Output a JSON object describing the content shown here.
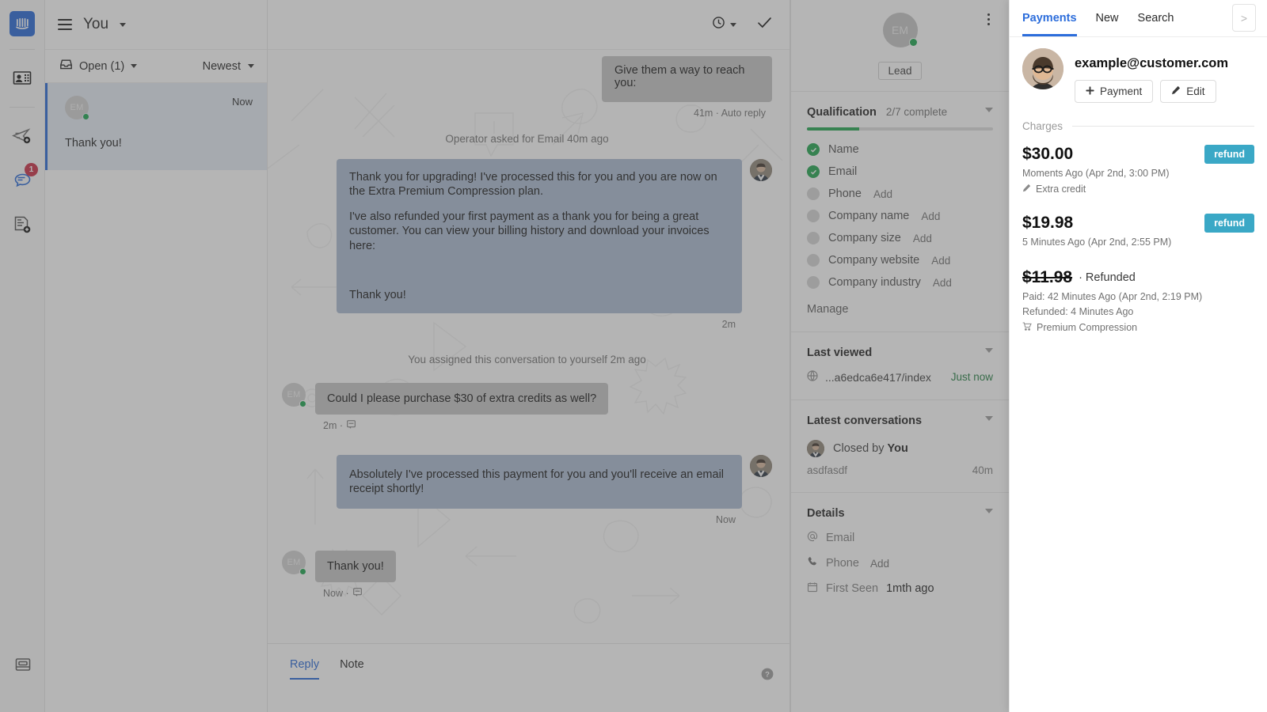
{
  "rail": {
    "logo_name": "intercom-logo",
    "items": [
      {
        "name": "contacts-icon",
        "badge": null
      },
      {
        "name": "send-message-icon",
        "badge": null
      },
      {
        "name": "conversations-icon",
        "badge": "1"
      },
      {
        "name": "articles-icon",
        "badge": null
      }
    ],
    "bottom_item": {
      "name": "inbox-icon"
    }
  },
  "conversation_list": {
    "header_title": "You",
    "filter_label": "Open (1)",
    "sort_label": "Newest",
    "items": [
      {
        "avatar_initials": "EM",
        "time": "Now",
        "snippet": "Thank you!"
      }
    ]
  },
  "conversation": {
    "header": {
      "snooze_icon": "clock-icon",
      "close_icon": "check-icon"
    },
    "messages": [
      {
        "type": "admin-partial",
        "text": "Give them a way to reach you:",
        "meta": "41m · Auto reply"
      },
      {
        "type": "system",
        "text": "Operator asked for Email 40m ago"
      },
      {
        "type": "admin",
        "paragraphs": [
          "Thank you for upgrading! I've processed this for you and you are now on the Extra Premium Compression plan.",
          "I've also refunded your first payment as a thank you for being a great customer. You can view your billing history and download your invoices here:",
          "",
          "Thank you!"
        ],
        "meta": "2m"
      },
      {
        "type": "system",
        "text": "You assigned this conversation to yourself 2m ago"
      },
      {
        "type": "user",
        "avatar_initials": "EM",
        "text": "Could I please purchase $30 of extra credits as well?",
        "meta": "2m ·"
      },
      {
        "type": "admin",
        "paragraphs": [
          "Absolutely I've processed this payment for you and you'll receive an email receipt shortly!"
        ],
        "meta": "Now"
      },
      {
        "type": "user",
        "avatar_initials": "EM",
        "text": "Thank you!",
        "meta": "Now ·"
      }
    ],
    "composer": {
      "tabs": [
        {
          "label": "Reply",
          "active": true
        },
        {
          "label": "Note",
          "active": false
        }
      ],
      "help_icon": "help-icon"
    }
  },
  "contact": {
    "avatar_initials": "EM",
    "badge": "Lead",
    "qualification": {
      "title": "Qualification",
      "subtitle": "2/7 complete",
      "progress_percent": 28,
      "rows": [
        {
          "label": "Name",
          "done": true,
          "action": ""
        },
        {
          "label": "Email",
          "done": true,
          "action": ""
        },
        {
          "label": "Phone",
          "done": false,
          "action": "Add"
        },
        {
          "label": "Company name",
          "done": false,
          "action": "Add"
        },
        {
          "label": "Company size",
          "done": false,
          "action": "Add"
        },
        {
          "label": "Company website",
          "done": false,
          "action": "Add"
        },
        {
          "label": "Company industry",
          "done": false,
          "action": "Add"
        }
      ],
      "manage_label": "Manage"
    },
    "last_viewed": {
      "title": "Last viewed",
      "page": "...a6edca6e417/index",
      "when": "Just now"
    },
    "latest_conversations": {
      "title": "Latest conversations",
      "items": [
        {
          "title_prefix": "Closed by ",
          "title_author": "You",
          "snippet": "asdfasdf",
          "time": "40m"
        }
      ]
    },
    "details": {
      "title": "Details",
      "rows": [
        {
          "icon": "at-icon",
          "label": "Email",
          "value": ""
        },
        {
          "icon": "phone-icon",
          "label": "Phone",
          "value": "Add"
        },
        {
          "icon": "calendar-icon",
          "label": "First Seen",
          "value": "1mth ago"
        }
      ]
    }
  },
  "payments": {
    "tabs": [
      {
        "label": "Payments",
        "active": true
      },
      {
        "label": "New",
        "active": false
      },
      {
        "label": "Search",
        "active": false
      }
    ],
    "next_button_label": ">",
    "customer_email": "example@customer.com",
    "buttons": [
      {
        "label": "Payment",
        "icon": "plus-icon"
      },
      {
        "label": "Edit",
        "icon": "pencil-icon"
      }
    ],
    "charges_label": "Charges",
    "charges": [
      {
        "amount": "$30.00",
        "refunded": false,
        "state": "",
        "action_label": "refund",
        "lines": [
          "Moments Ago (Apr 2nd, 3:00 PM)"
        ],
        "icon_line": {
          "icon": "pencil-icon",
          "text": "Extra credit"
        }
      },
      {
        "amount": "$19.98",
        "refunded": false,
        "state": "",
        "action_label": "refund",
        "lines": [
          "5 Minutes Ago (Apr 2nd, 2:55 PM)"
        ],
        "icon_line": null
      },
      {
        "amount": "$11.98",
        "refunded": true,
        "state": "· Refunded",
        "action_label": "",
        "lines": [
          "Paid: 42 Minutes Ago (Apr 2nd, 2:19 PM)",
          "Refunded: 4 Minutes Ago"
        ],
        "icon_line": {
          "icon": "cart-icon",
          "text": "Premium Compression"
        }
      }
    ]
  },
  "colors": {
    "brand_blue": "#1f63d6",
    "link_blue": "#2c6ddb",
    "refund_teal": "#3aa8c6",
    "progress_green": "#1aa34a",
    "badge_red": "#c9273f",
    "admin_bubble": "#a8b8cf",
    "user_bubble": "#c4c4c4"
  }
}
